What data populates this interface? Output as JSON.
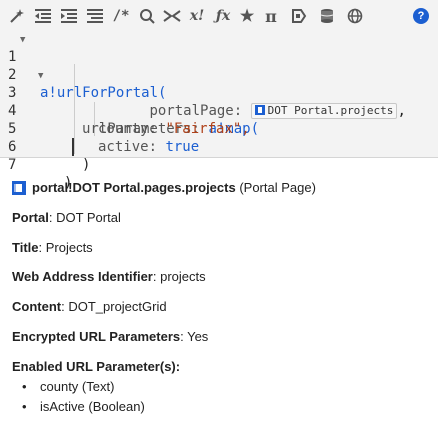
{
  "toolbar": {
    "help_label": "?",
    "buttons": [
      {
        "name": "magic-wand-icon",
        "glyph": "✎"
      },
      {
        "name": "indent-decrease-icon",
        "glyph": "≡"
      },
      {
        "name": "indent-increase-icon",
        "glyph": "≡"
      },
      {
        "name": "format-lines-icon",
        "glyph": "≡"
      },
      {
        "name": "comment-icon",
        "glyph": "/*"
      },
      {
        "name": "search-icon",
        "glyph": "Q"
      },
      {
        "name": "expand-collapse-icon",
        "glyph": "⤭"
      },
      {
        "name": "expression-icon",
        "glyph": "x!"
      },
      {
        "name": "function-icon",
        "glyph": "ƒ"
      },
      {
        "name": "star-icon",
        "glyph": "★"
      },
      {
        "name": "pi-icon",
        "glyph": "π"
      },
      {
        "name": "rule-icon",
        "glyph": "⊳"
      },
      {
        "name": "data-icon",
        "glyph": "≣"
      },
      {
        "name": "globe-icon",
        "glyph": "⊕"
      }
    ]
  },
  "code": {
    "line_numbers": [
      "1",
      "2",
      "3",
      "4",
      "5",
      "6",
      "7"
    ],
    "l1": "a!urlForPortal(",
    "l2_key": "portalPage: ",
    "l2_chip": "DOT Portal.projects",
    "l2_end": ",",
    "l3_key": "urlParameters: ",
    "l3_fn": "a!map(",
    "l4_key": "county: ",
    "l4_val": "\"Fairfax\",",
    "l5_key": "active: ",
    "l5_val": "true",
    "l6": ")",
    "l7": ")"
  },
  "details": {
    "header_name": "portal!DOT Portal.pages.projects",
    "header_type": "(Portal Page)",
    "portal_label": "Portal",
    "portal_value": ": DOT Portal",
    "title_label": "Title",
    "title_value": ": Projects",
    "web_label": "Web Address Identifier",
    "web_value": ": projects",
    "content_label": "Content",
    "content_value": ": DOT_projectGrid",
    "enc_label": "Encrypted URL Parameters",
    "enc_value": ": Yes",
    "enabled_label": "Enabled URL Parameter(s):",
    "params": [
      "county (Text)",
      "isActive (Boolean)"
    ]
  }
}
